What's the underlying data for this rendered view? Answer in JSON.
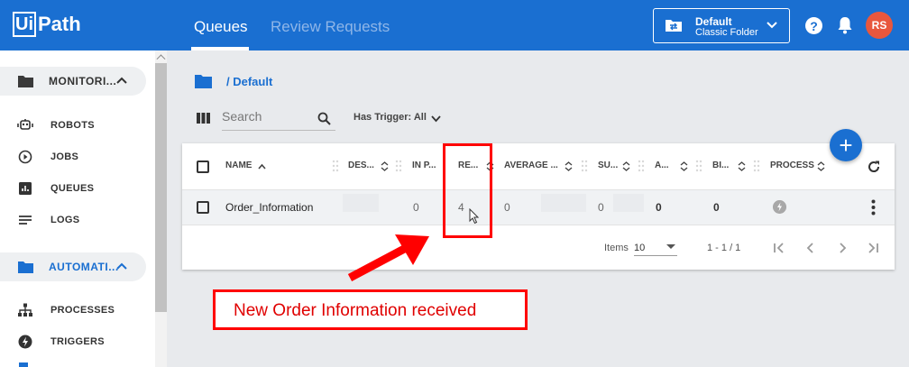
{
  "header": {
    "logo_box": "Ui",
    "logo_text": "Path",
    "tabs": [
      "Queues",
      "Review Requests"
    ],
    "folder": {
      "name": "Default",
      "type": "Classic Folder"
    },
    "help": "?",
    "avatar_initials": "RS",
    "brand_color": "#1a6fd1"
  },
  "sidebar": {
    "sections": [
      {
        "label": "MONITORI...",
        "icon": "folder-icon"
      },
      {
        "label": "AUTOMATI...",
        "icon": "folder-icon"
      }
    ],
    "monitoring_items": [
      {
        "label": "ROBOTS",
        "icon": "robot-icon"
      },
      {
        "label": "JOBS",
        "icon": "play-circle-icon"
      },
      {
        "label": "QUEUES",
        "icon": "bar-chart-icon"
      },
      {
        "label": "LOGS",
        "icon": "list-icon"
      }
    ],
    "automation_items": [
      {
        "label": "PROCESSES",
        "icon": "hierarchy-icon"
      },
      {
        "label": "TRIGGERS",
        "icon": "lightning-icon"
      }
    ]
  },
  "main": {
    "breadcrumb": "/ Default",
    "search_placeholder": "Search",
    "filter_label": "Has Trigger: All",
    "table": {
      "columns": [
        "NAME",
        "DES...",
        "IN P...",
        "RE...",
        "AVERAGE ...",
        "SU...",
        "A...",
        "BI...",
        "PROCESS"
      ],
      "rows": [
        {
          "name": "Order_Information",
          "in_progress": "0",
          "remaining": "4",
          "average": "0",
          "successful": "0",
          "app_exceptions": "0",
          "biz_exceptions": "0"
        }
      ]
    },
    "pager": {
      "items_label": "Items",
      "page_size": "10",
      "range": "1 - 1 / 1"
    }
  },
  "annotation": {
    "callout": "New Order Information received",
    "color": "#ff0000"
  }
}
